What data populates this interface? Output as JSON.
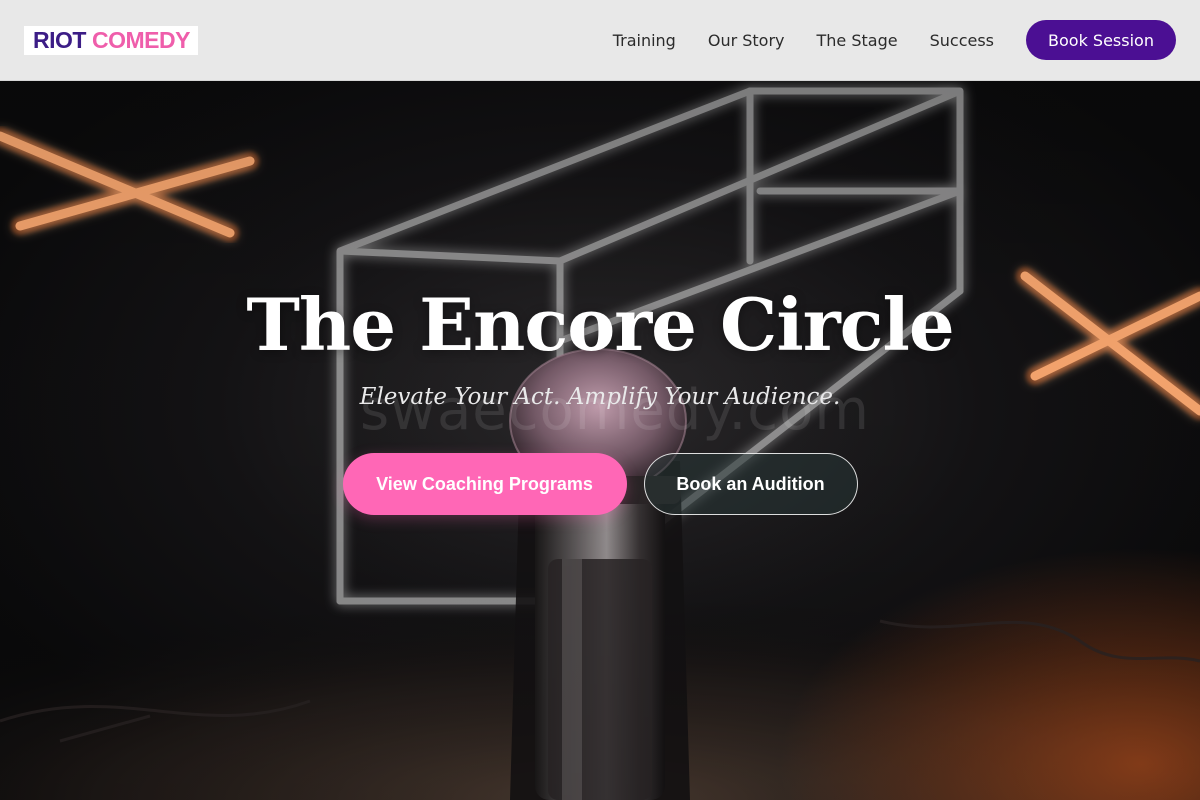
{
  "brand": {
    "logo_part_1": "RIOT",
    "logo_part_2": "COMEDY",
    "color_primary": "#3c1d86",
    "color_accent": "#ef5eab"
  },
  "nav": {
    "links": [
      "Training",
      "Our Story",
      "The Stage",
      "Success"
    ],
    "cta_label": "Book Session",
    "cta_color": "#4b0f93"
  },
  "hero": {
    "title": "The Encore Circle",
    "subtitle": "Elevate Your Act. Amplify Your Audience.",
    "watermark": "swaecomedy.com",
    "primary_button": "View Coaching Programs",
    "secondary_button": "Book an Audition",
    "primary_color": "#ff67b6",
    "background": "stage-with-microphone-and-neon-lights-image"
  }
}
